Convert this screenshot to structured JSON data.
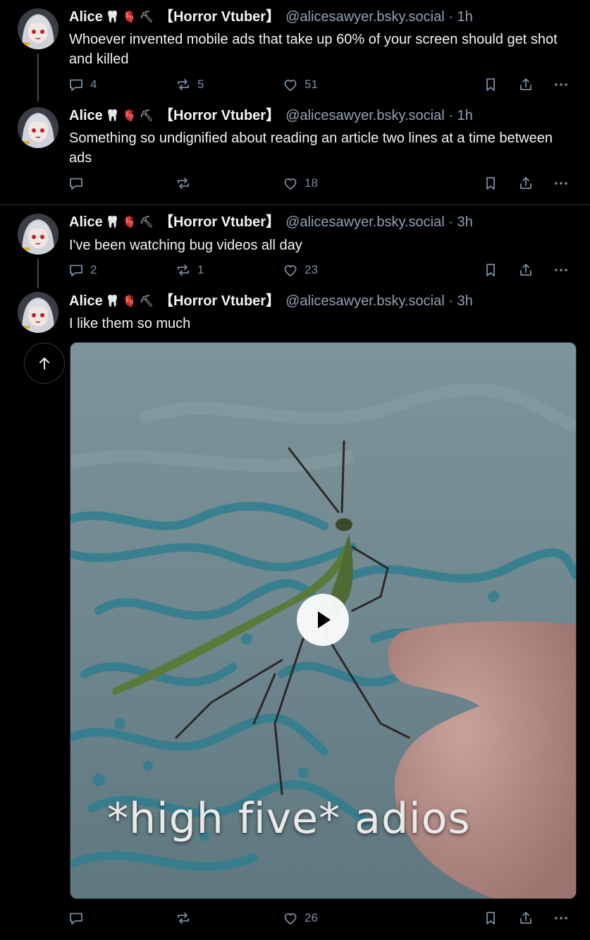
{
  "author": {
    "display_name": "Alice",
    "emojis": [
      "🦷",
      "🫀",
      "⛏"
    ],
    "tag": "【Horror Vtuber】",
    "handle": "@alicesawyer.bsky.social"
  },
  "posts": [
    {
      "time": "· 1h",
      "text": "Whoever invented mobile ads that take up 60% of your screen should get shot and killed",
      "replies": "4",
      "reposts": "5",
      "likes": "51"
    },
    {
      "time": "· 1h",
      "text": "Something so undignified about reading an article two lines at a time between ads",
      "replies": "",
      "reposts": "",
      "likes": "18"
    },
    {
      "time": "· 3h",
      "text": "I've been watching bug videos all day",
      "replies": "2",
      "reposts": "1",
      "likes": "23"
    },
    {
      "time": "· 3h",
      "text": "I like them so much",
      "replies": "",
      "reposts": "",
      "likes": "26",
      "video": {
        "caption": "*high five* adios",
        "play_icon": "play-icon"
      }
    }
  ],
  "icons": {
    "reply": "reply-icon",
    "repost": "repost-icon",
    "like": "heart-icon",
    "bookmark": "bookmark-icon",
    "share": "share-icon",
    "more": "more-icon",
    "scroll_top": "arrow-up-icon"
  },
  "colors": {
    "background": "#000000",
    "muted": "#788ba0",
    "handle": "#92a2b5"
  }
}
